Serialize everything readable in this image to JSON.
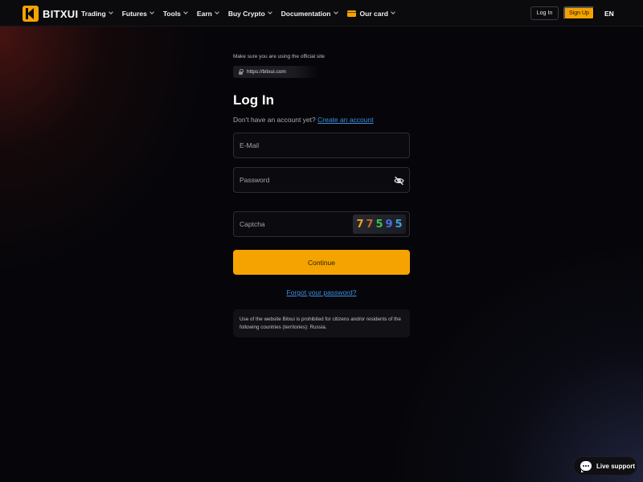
{
  "nav": {
    "brand": "BITXUI",
    "menu": [
      {
        "label": "Trading"
      },
      {
        "label": "Futures"
      },
      {
        "label": "Tools"
      },
      {
        "label": "Earn"
      },
      {
        "label": "Buy Crypto"
      },
      {
        "label": "Documentation"
      },
      {
        "label": "Our card",
        "icon": "card-icon"
      }
    ],
    "login_label": "Log In",
    "signup_label": "Sign Up",
    "language": "EN"
  },
  "security": {
    "notice": "Make sure you are using the official site",
    "url": "https://bitxui.com"
  },
  "form": {
    "title": "Log In",
    "subtitle_text": "Don't have an account yet?",
    "create_account_link": "Create an account",
    "email_placeholder": "E-Mail",
    "password_placeholder": "Password",
    "captcha_placeholder": "Captcha",
    "captcha_digits": [
      {
        "char": "7",
        "color": "#f0a21e"
      },
      {
        "char": "7",
        "color": "#c46a2a"
      },
      {
        "char": "5",
        "color": "#3fbf4f"
      },
      {
        "char": "9",
        "color": "#4a6ee8"
      },
      {
        "char": "5",
        "color": "#3aa6d6"
      }
    ],
    "continue_label": "Continue",
    "forgot_link": "Forgot your password?",
    "legal_text": "Use of the website Bitxui is prohibited for citizens and/or residents of the following countries (territories): Russia."
  },
  "support": {
    "label": "Live support"
  },
  "colors": {
    "accent": "#f5a300",
    "link": "#3d8fe0",
    "background": "#06060a"
  }
}
